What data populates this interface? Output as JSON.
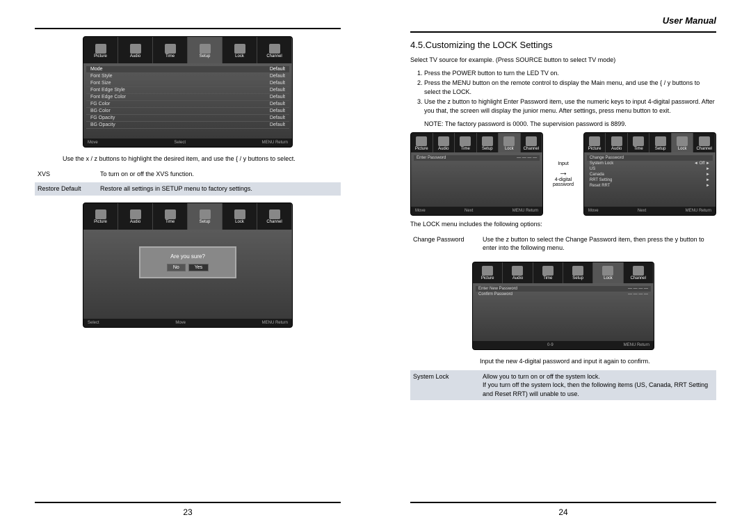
{
  "header": {
    "title": "User Manual"
  },
  "left_page": {
    "screenshot1": {
      "tabs": [
        "Picture",
        "Audio",
        "Time",
        "Setup",
        "Lock",
        "Channel"
      ],
      "header_mode": "Mode",
      "header_default": "Default",
      "rows": [
        {
          "label": "Font Style",
          "value": "Default"
        },
        {
          "label": "Font Size",
          "value": "Default"
        },
        {
          "label": "Font Edge Style",
          "value": "Default"
        },
        {
          "label": "Font Edge Color",
          "value": "Default"
        },
        {
          "label": "FG Color",
          "value": "Default"
        },
        {
          "label": "BG Color",
          "value": "Default"
        },
        {
          "label": "FG Opacity",
          "value": "Default"
        },
        {
          "label": "BG Opacity",
          "value": "Default"
        }
      ],
      "footer": {
        "move": "Move",
        "select": "Select",
        "ret": "MENU Return"
      }
    },
    "instruction1": "Use the x / z buttons to highlight the desired item, and use the { / y buttons to select.",
    "xvs_label": "XVS",
    "xvs_desc": "To turn on or off the XVS function.",
    "restore_label": "Restore Default",
    "restore_desc": "Restore all settings in SETUP menu to factory settings.",
    "screenshot2": {
      "dialog_text": "Are you sure?",
      "btn_no": "No",
      "btn_yes": "Yes",
      "footer": {
        "select": "Select",
        "move": "Move",
        "ret": "MENU Return"
      }
    },
    "page_number": "23"
  },
  "right_page": {
    "section_title": "4.5.Customizing the LOCK Settings",
    "intro": "Select TV source for example. (Press SOURCE button to select TV mode)",
    "steps": [
      "Press the POWER button to turn the LED TV on.",
      "Press the MENU button on the remote control to display the Main menu, and use the { / y buttons to select the LOCK.",
      "Use the z button to highlight Enter Password item, use the numeric keys to input 4-digital password. After you that, the screen will display the junior menu. After settings, press menu button to exit."
    ],
    "note": "NOTE: The factory password is 0000. The supervision password is 8899.",
    "dual_shot": {
      "left_title": "Enter Password",
      "arrow_text1": "Input",
      "arrow_text2": "4-digital password",
      "right_rows": [
        {
          "label": "Change Password",
          "value": ""
        },
        {
          "label": "System Lock",
          "value": "Off"
        },
        {
          "label": "US",
          "value": ""
        },
        {
          "label": "Canada",
          "value": ""
        },
        {
          "label": "RRT Setting",
          "value": ""
        },
        {
          "label": "Reset RRT",
          "value": ""
        }
      ],
      "footer": {
        "move": "Move",
        "next": "Next",
        "ret": "MENU Return"
      }
    },
    "options_intro": "The LOCK menu includes the following options:",
    "change_pw_label": "Change Password",
    "change_pw_desc": "Use the z button to select the Change Password item, then press the y button to enter into the following menu.",
    "screenshot3": {
      "row1": "Enter New Password",
      "row2": "Confirm Password",
      "footer": {
        "keys": "0-9",
        "ret": "MENU Return"
      }
    },
    "confirm_text": "Input the new 4-digital password and input it again to confirm.",
    "syslock_label": "System Lock",
    "syslock_desc": "Allow you to turn on or off the system lock.\nIf you turn off the system lock, then the following items (US, Canada, RRT Setting and Reset RRT) will unable to use.",
    "page_number": "24"
  }
}
